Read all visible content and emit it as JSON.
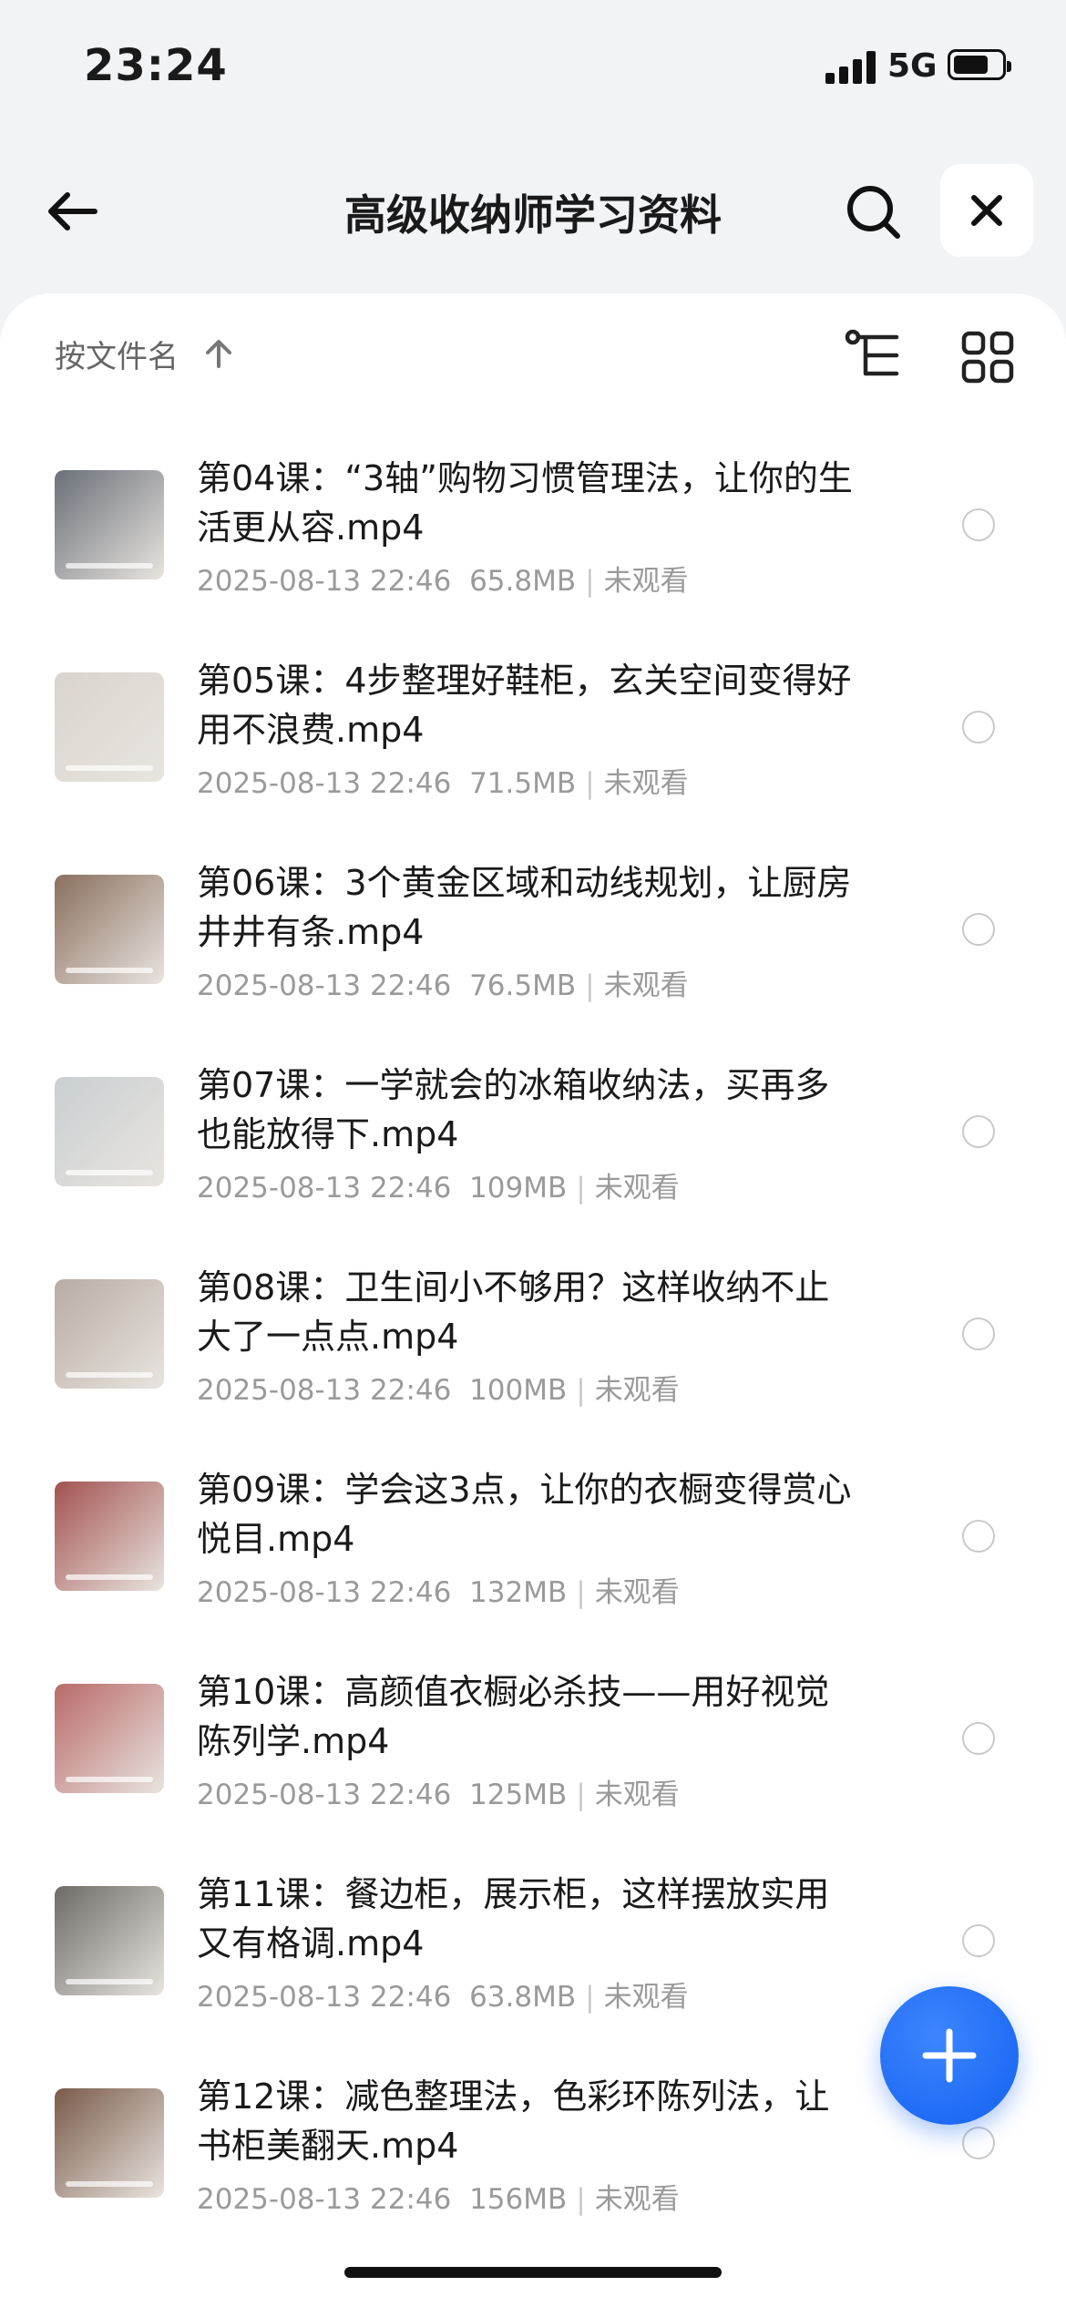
{
  "status": {
    "time": "23:24",
    "network": "5G",
    "battery_level": 0.72
  },
  "header": {
    "title": "高级收纳师学习资料"
  },
  "toolbar": {
    "sort_label": "按文件名"
  },
  "files": [
    {
      "title": "第04课：“3轴”购物习惯管理法，让你的生活更从容.mp4",
      "date": "2025-08-13 22:46",
      "size": "65.8MB",
      "status": "未观看",
      "thumb_color": "#6a6f78"
    },
    {
      "title": "第05课：4步整理好鞋柜，玄关空间变得好用不浪费.mp4",
      "date": "2025-08-13 22:46",
      "size": "71.5MB",
      "status": "未观看",
      "thumb_color": "#d9d4cc"
    },
    {
      "title": "第06课：3个黄金区域和动线规划，让厨房井井有条.mp4",
      "date": "2025-08-13 22:46",
      "size": "76.5MB",
      "status": "未观看",
      "thumb_color": "#8a6f5e"
    },
    {
      "title": "第07课：一学就会的冰箱收纳法，买再多也能放得下.mp4",
      "date": "2025-08-13 22:46",
      "size": "109MB",
      "status": "未观看",
      "thumb_color": "#c9cfd1"
    },
    {
      "title": "第08课：卫生间小不够用？这样收纳不止大了一点点.mp4",
      "date": "2025-08-13 22:46",
      "size": "100MB",
      "status": "未观看",
      "thumb_color": "#b8aca3"
    },
    {
      "title": "第09课：学会这3点，让你的衣橱变得赏心悦目.mp4",
      "date": "2025-08-13 22:46",
      "size": "132MB",
      "status": "未观看",
      "thumb_color": "#a35250"
    },
    {
      "title": "第10课：高颜值衣橱必杀技——用好视觉陈列学.mp4",
      "date": "2025-08-13 22:46",
      "size": "125MB",
      "status": "未观看",
      "thumb_color": "#b96a6a"
    },
    {
      "title": "第11课：餐边柜，展示柜，这样摆放实用又有格调.mp4",
      "date": "2025-08-13 22:46",
      "size": "63.8MB",
      "status": "未观看",
      "thumb_color": "#6e6a66"
    },
    {
      "title": "第12课：减色整理法，色彩环陈列法，让书柜美翻天.mp4",
      "date": "2025-08-13 22:46",
      "size": "156MB",
      "status": "未观看",
      "thumb_color": "#7a5a4a"
    }
  ],
  "icons": {
    "back": "arrow-left-icon",
    "search": "search-icon",
    "close": "close-icon",
    "sort_direction": "arrow-up-icon",
    "tree": "tree-view-icon",
    "grid": "grid-view-icon",
    "add": "plus-icon"
  },
  "colors": {
    "accent": "#1a66f5",
    "background": "#f2f3f5",
    "muted_text": "#9a9a9a"
  }
}
